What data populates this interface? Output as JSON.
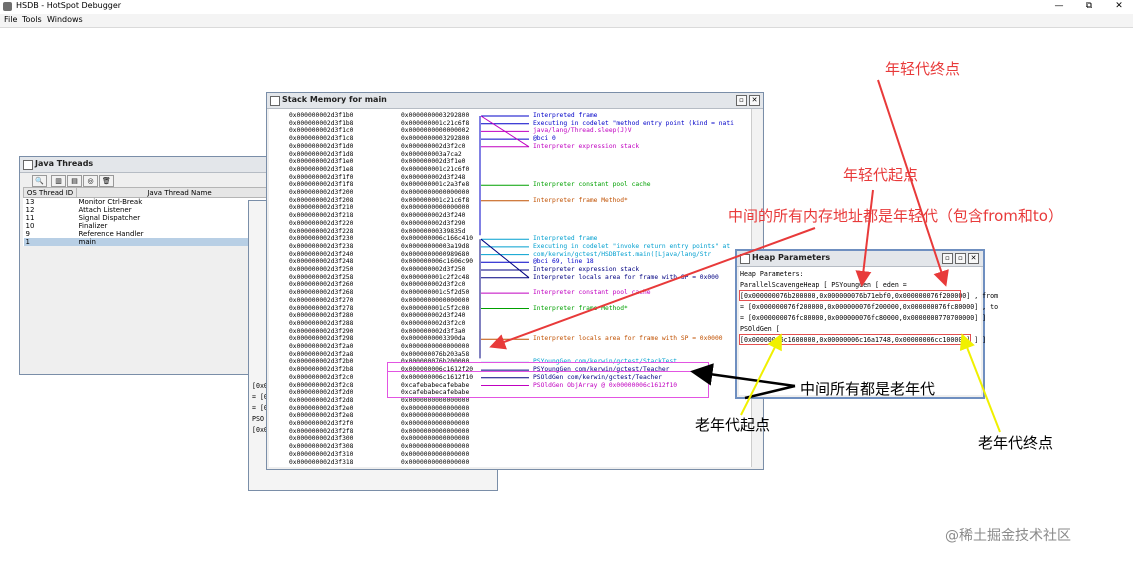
{
  "app": {
    "title": "HSDB - HotSpot Debugger",
    "controls": [
      "—",
      "⧉",
      "✕"
    ],
    "menu": [
      "File",
      "Tools",
      "Windows"
    ]
  },
  "java_threads": {
    "title": "Java Threads",
    "columns": [
      "OS Thread ID",
      "Java Thread Name"
    ],
    "rows": [
      {
        "id": "13",
        "name": "Monitor Ctrl-Break"
      },
      {
        "id": "12",
        "name": "Attach Listener"
      },
      {
        "id": "11",
        "name": "Signal Dispatcher"
      },
      {
        "id": "10",
        "name": "Finalizer"
      },
      {
        "id": "9",
        "name": "Reference Handler"
      },
      {
        "id": "1",
        "name": "main"
      }
    ],
    "selected_row": 5
  },
  "back_window": {
    "lines": [
      "[0x0",
      "= [0",
      "= [0",
      "PSO",
      "[0x0"
    ]
  },
  "stack_memory": {
    "title": "Stack Memory for main",
    "addresses": [
      "0x000000002d3f1b0",
      "0x000000002d3f1b8",
      "0x000000002d3f1c0",
      "0x000000002d3f1c8",
      "0x000000002d3f1d0",
      "0x000000002d3f1d8",
      "0x000000002d3f1e0",
      "0x000000002d3f1e8",
      "0x000000002d3f1f0",
      "0x000000002d3f1f8",
      "0x000000002d3f200",
      "0x000000002d3f208",
      "0x000000002d3f210",
      "0x000000002d3f218",
      "0x000000002d3f220",
      "0x000000002d3f228",
      "0x000000002d3f230",
      "0x000000002d3f238",
      "0x000000002d3f240",
      "0x000000002d3f248",
      "0x000000002d3f250",
      "0x000000002d3f258",
      "0x000000002d3f260",
      "0x000000002d3f268",
      "0x000000002d3f270",
      "0x000000002d3f278",
      "0x000000002d3f280",
      "0x000000002d3f288",
      "0x000000002d3f290",
      "0x000000002d3f298",
      "0x000000002d3f2a0",
      "0x000000002d3f2a8",
      "0x000000002d3f2b0",
      "0x000000002d3f2b8",
      "0x000000002d3f2c0",
      "0x000000002d3f2c8",
      "0x000000002d3f2d0",
      "0x000000002d3f2d8",
      "0x000000002d3f2e0",
      "0x000000002d3f2e8",
      "0x000000002d3f2f0",
      "0x000000002d3f2f8",
      "0x000000002d3f300",
      "0x000000002d3f308",
      "0x000000002d3f310",
      "0x000000002d3f318"
    ],
    "values": [
      "0x0000000003292800",
      "0x000000001c21c6f8",
      "0x0000000000000002",
      "0x0000000003292800",
      "0x000000002d3f2c0",
      "0x000000003a7ca2",
      "0x000000002d3f1e0",
      "0x000000001c21c6f0",
      "0x000000002d3f248",
      "0x000000001c2a3fe8",
      "0x0000000000000000",
      "0x000000001c21c6f8",
      "0x0000000000000000",
      "0x000000002d3f240",
      "0x000000002d3f290",
      "0x00000000339835d",
      "0x000000006c166c410",
      "0x00000000003a19d8",
      "0x0000000000989680",
      "0x000000006c1606c90",
      "0x000000002d3f250",
      "0x000000001c2f2c48",
      "0x000000002d3f2c0",
      "0x000000001c5f2d50",
      "0x0000000000000000",
      "0x000000001c5f2c00",
      "0x000000002d3f240",
      "0x000000002d3f2c0",
      "0x000000002d3f3a0",
      "0x0000000003390da",
      "0x0000000000000000",
      "0x000000076b203a58",
      "0x000000076b200000",
      "0x000000006c1612f20",
      "0x000000006c1612f10",
      "0xcafebabecafebabe",
      "0xcafebabecafebabe",
      "0x0000000000000000",
      "0x0000000000000000",
      "0x0000000000000000",
      "0x0000000000000000",
      "0x0000000000000000",
      "0x0000000000000000",
      "0x0000000000000000",
      "0x0000000000000000",
      "0x0000000000000000"
    ],
    "annotations": [
      {
        "text": "Interpreted frame",
        "row": 0,
        "color": "#0000c8"
      },
      {
        "text": "Executing in codelet \"method entry point (kind = nati",
        "row": 1,
        "color": "#0000c8"
      },
      {
        "text": "java/lang/Thread.sleep(J)V",
        "row": 2,
        "color": "#c000c0"
      },
      {
        "text": "@bci 0",
        "row": 3,
        "color": "#0000c8"
      },
      {
        "text": "Interpreter expression stack",
        "row": 4,
        "color": "#c000c0"
      },
      {
        "text": "Interpreter constant pool cache",
        "row": 9,
        "color": "#00a000"
      },
      {
        "text": "Interpreter frame Method*",
        "row": 11,
        "color": "#c05000"
      },
      {
        "text": "Interpreted frame",
        "row": 16,
        "color": "#009fcf"
      },
      {
        "text": "Executing in codelet \"invoke return entry points\" at",
        "row": 17,
        "color": "#009fcf"
      },
      {
        "text": "com/kerwin/gctest/HSDBTest.main([Ljava/lang/Str",
        "row": 18,
        "color": "#009fcf"
      },
      {
        "text": "@bci 69, line 18",
        "row": 19,
        "color": "#0000c8"
      },
      {
        "text": "Interpreter expression stack",
        "row": 20,
        "color": "#000080"
      },
      {
        "text": "Interpreter locals area for frame with SP = 0x000",
        "row": 21,
        "color": "#000080"
      },
      {
        "text": "Interpreter constant pool cache",
        "row": 23,
        "color": "#c000c0"
      },
      {
        "text": "Interpreter frame Method*",
        "row": 25,
        "color": "#00a000"
      },
      {
        "text": "Interpreter locals area for frame with SP = 0x0000",
        "row": 29,
        "color": "#c05000"
      },
      {
        "text": "PSYoungGen com/kerwin/gctest/StackTest",
        "row": 32,
        "color": "#009fcf"
      },
      {
        "text": "PSYoungGen com/kerwin/gctest/Teacher",
        "row": 33,
        "color": "#000080"
      },
      {
        "text": "PSOldGen com/kerwin/gctest/Teacher",
        "row": 34,
        "color": "#000080"
      },
      {
        "text": "PSOldGen ObjArray @ 0x00000006c1612f10",
        "row": 35,
        "color": "#c000c0"
      }
    ]
  },
  "heap_params": {
    "title": "Heap Parameters",
    "lines": [
      "Heap Parameters:",
      "ParallelScavengeHeap [ PSYoungGen [ eden =",
      "[0x000000076b200000,0x000000076b71ebf0,0x000000076f200000] , from",
      "= [0x000000076f200000,0x000000076f200000,0x000000076fc80000] , to",
      "= [0x000000076fc80000,0x000000076fc80000,0x0000000770700000] ]",
      "PSOldGen [",
      "[0x00000006c1600000,0x00000006c16a1748,0x00000006cc100000] ] ]"
    ]
  },
  "callouts": {
    "young_end": "年轻代终点",
    "young_start": "年轻代起点",
    "young_range": "中间的所有内存地址都是年轻代（包含from和to）",
    "old_middle": "中间所有都是老年代",
    "old_start": "老年代起点",
    "old_end": "老年代终点",
    "watermark": "@稀土掘金技术社区"
  },
  "colors": {
    "callout_red": "#e83a3a",
    "callout_yellow": "#f5f500",
    "window_border": "#7a8ea8"
  }
}
